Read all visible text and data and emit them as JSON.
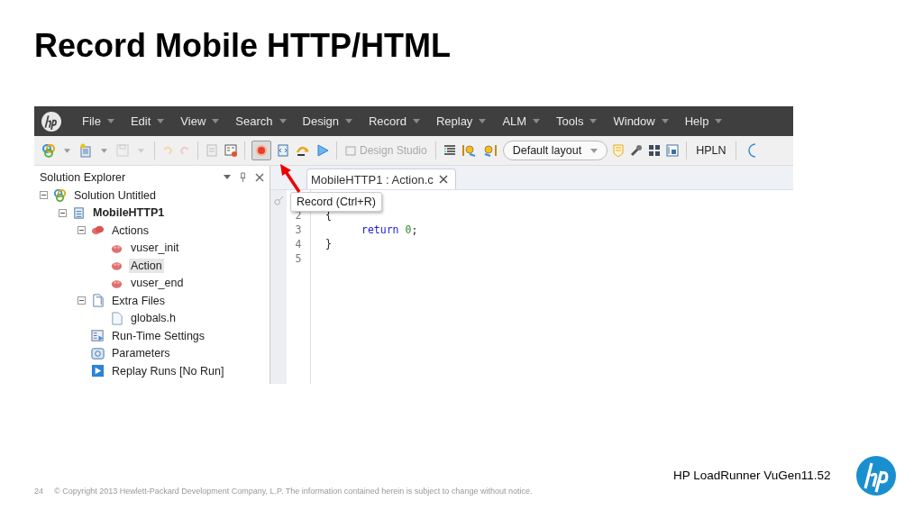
{
  "slide": {
    "title": "Record Mobile HTTP/HTML"
  },
  "app": {
    "menu": [
      {
        "label": "File"
      },
      {
        "label": "Edit"
      },
      {
        "label": "View"
      },
      {
        "label": "Search"
      },
      {
        "label": "Design"
      },
      {
        "label": "Record"
      },
      {
        "label": "Replay"
      },
      {
        "label": "ALM"
      },
      {
        "label": "Tools"
      },
      {
        "label": "Window"
      },
      {
        "label": "Help"
      }
    ],
    "toolbar": {
      "record_highlighted": true,
      "design_studio": {
        "label": "Design Studio",
        "disabled": true
      },
      "layout": {
        "value": "Default layout"
      },
      "hpln": "HPLN"
    },
    "explorer": {
      "title": "Solution Explorer",
      "tree": [
        {
          "label": "Solution Untitled",
          "kind": "solution",
          "expanded": true,
          "selected": false,
          "bold": false,
          "children": [
            {
              "label": "MobileHTTP1",
              "kind": "script",
              "expanded": true,
              "selected": false,
              "bold": true,
              "children": [
                {
                  "label": "Actions",
                  "kind": "actions",
                  "expanded": true,
                  "selected": false,
                  "bold": false,
                  "children": [
                    {
                      "label": "vuser_init",
                      "kind": "action",
                      "selected": false,
                      "bold": false
                    },
                    {
                      "label": "Action",
                      "kind": "action",
                      "selected": true,
                      "bold": false
                    },
                    {
                      "label": "vuser_end",
                      "kind": "action",
                      "selected": false,
                      "bold": false
                    }
                  ]
                },
                {
                  "label": "Extra Files",
                  "kind": "files",
                  "expanded": true,
                  "selected": false,
                  "bold": false,
                  "children": [
                    {
                      "label": "globals.h",
                      "kind": "file",
                      "selected": false,
                      "bold": false
                    }
                  ]
                },
                {
                  "label": "Run-Time Settings",
                  "kind": "settings",
                  "selected": false,
                  "bold": false
                },
                {
                  "label": "Parameters",
                  "kind": "parameters",
                  "selected": false,
                  "bold": false
                },
                {
                  "label": "Replay Runs [No Run]",
                  "kind": "replay",
                  "selected": false,
                  "bold": false
                }
              ]
            }
          ]
        }
      ]
    },
    "editor": {
      "tab": "MobileHTTP1 : Action.c",
      "tooltip": "Record (Ctrl+R)",
      "lines": [
        {
          "number": "2",
          "indented": false,
          "tokens": [
            {
              "text": "{",
              "kind": "plain"
            }
          ]
        },
        {
          "number": "3",
          "indented": true,
          "tokens": [
            {
              "text": "return",
              "kind": "keyword"
            },
            {
              "text": "0",
              "kind": "number"
            },
            {
              "text": ";",
              "kind": "plain"
            }
          ]
        },
        {
          "number": "4",
          "indented": false,
          "tokens": [
            {
              "text": "}",
              "kind": "plain"
            }
          ]
        },
        {
          "number": "5"
        }
      ]
    }
  },
  "footer": {
    "page": "24",
    "copyright": "© Copyright 2013 Hewlett-Packard Development Company, L.P.  The information contained herein is subject to change without notice.",
    "product": "HP LoadRunner VuGen11.52"
  }
}
